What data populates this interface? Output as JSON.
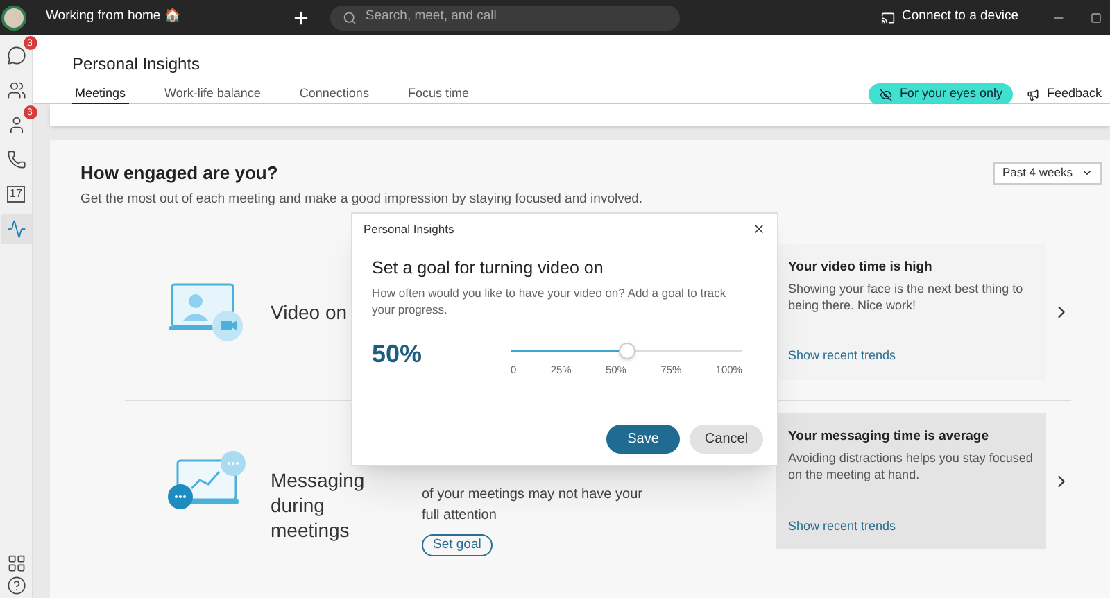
{
  "top_bar": {
    "status": "Working from home 🏠",
    "search": {
      "placeholder": "Search, meet, and call"
    },
    "connect": "Connect to a device"
  },
  "sidebar": {
    "items": [
      {
        "kind": "chat",
        "badge": "3",
        "selected": false
      },
      {
        "kind": "teams",
        "selected": false
      },
      {
        "kind": "people",
        "badge": "3",
        "selected": false
      },
      {
        "kind": "phone",
        "selected": false
      },
      {
        "kind": "calendar",
        "label": "17",
        "selected": false
      },
      {
        "kind": "insights",
        "selected": true
      }
    ],
    "bottom": [
      {
        "kind": "apps"
      },
      {
        "kind": "help"
      }
    ]
  },
  "header": {
    "title": "Personal Insights",
    "tabs": [
      {
        "label": "Meetings",
        "selected": true
      },
      {
        "label": "Work-life balance",
        "selected": false
      },
      {
        "label": "Connections",
        "selected": false
      },
      {
        "label": "Focus time",
        "selected": false
      }
    ],
    "privacy_badge": "For your eyes only",
    "feedback": "Feedback"
  },
  "card": {
    "title": "How engaged are you?",
    "subtitle": "Get the most out of each meeting and make a good impression by staying focused and involved.",
    "period": "Past 4 weeks",
    "rows": [
      {
        "kind": "video",
        "label": "Video on",
        "insight": {
          "title": "Your video time is high",
          "text": "Showing your face is the next best thing to being there. Nice work!",
          "link": "Show recent trends"
        }
      },
      {
        "kind": "messaging",
        "label": "Messaging during meetings",
        "detail": "of your meetings may not have your full attention",
        "button": "Set goal",
        "insight": {
          "title": "Your messaging time is average",
          "text": "Avoiding distractions helps you stay focused on the meeting at hand.",
          "link": "Show recent trends"
        }
      }
    ]
  },
  "dialog": {
    "title": "Personal Insights",
    "heading": "Set a goal for turning video on",
    "description": "How often would you like to have your video on? Add a goal to track your progress.",
    "value": "50%",
    "slider": {
      "level": 0.5,
      "ticks": [
        "0",
        "25%",
        "50%",
        "75%",
        "100%"
      ]
    },
    "buttons": [
      {
        "label": "Save",
        "kind": "primary"
      },
      {
        "label": "Cancel",
        "kind": "secondary"
      }
    ]
  }
}
